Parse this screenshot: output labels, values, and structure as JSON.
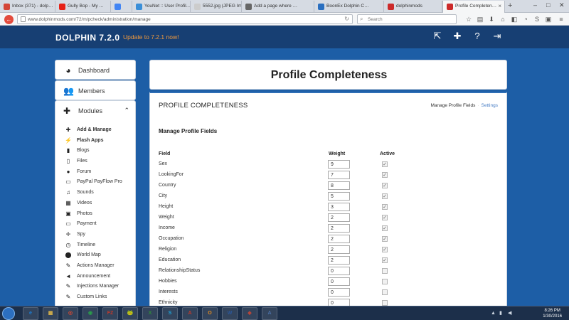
{
  "browser": {
    "tabs": [
      {
        "label": "Inbox (371) - dolp…",
        "color": "#d44638"
      },
      {
        "label": "Gully Bop - My …",
        "color": "#e62117"
      },
      {
        "label": "",
        "color": "#4285f4"
      },
      {
        "label": "YouNet :: User Profil…",
        "color": "#3b8fd8"
      },
      {
        "label": "5552.jpg (JPEG Ima…",
        "color": "#cccccc"
      },
      {
        "label": "Add a page where …",
        "color": "#666666"
      },
      {
        "label": "BoonEx Dolphin C…",
        "color": "#2a6fc0"
      },
      {
        "label": "dolphinmods",
        "color": "#cc2a2a"
      },
      {
        "label": "Profile Completen…",
        "color": "#cc2a2a"
      }
    ],
    "url": "www.dolphinmods.com/72/m/pcheck/administration/manage",
    "search_placeholder": "Search"
  },
  "header": {
    "brand": "DOLPHIN 7.2.0",
    "update_link": "Update to 7.2.1 now!"
  },
  "sidebar": {
    "dashboard": "Dashboard",
    "members": "Members",
    "modules": "Modules",
    "module_items": [
      {
        "label": "Add & Manage",
        "icon": "plus-icon",
        "bold": true
      },
      {
        "label": "Flash Apps",
        "icon": "bolt-icon",
        "bold": true
      },
      {
        "label": "Blogs",
        "icon": "book-icon",
        "bold": false
      },
      {
        "label": "Files",
        "icon": "file-icon",
        "bold": false
      },
      {
        "label": "Forum",
        "icon": "comments-icon",
        "bold": false
      },
      {
        "label": "PayPal PayFlow Pro",
        "icon": "card-icon",
        "bold": false
      },
      {
        "label": "Sounds",
        "icon": "music-icon",
        "bold": false
      },
      {
        "label": "Videos",
        "icon": "film-icon",
        "bold": false
      },
      {
        "label": "Photos",
        "icon": "photo-icon",
        "bold": false
      },
      {
        "label": "Payment",
        "icon": "card-icon",
        "bold": false
      },
      {
        "label": "Spy",
        "icon": "crosshair-icon",
        "bold": false
      },
      {
        "label": "Timeline",
        "icon": "clock-icon",
        "bold": false
      },
      {
        "label": "World Map",
        "icon": "map-marker-icon",
        "bold": false
      },
      {
        "label": "Actions Manager",
        "icon": "wrench-icon",
        "bold": false
      },
      {
        "label": "Announcement",
        "icon": "bullhorn-icon",
        "bold": false
      },
      {
        "label": "Injections Manager",
        "icon": "wrench-icon",
        "bold": false
      },
      {
        "label": "Custom Links",
        "icon": "wrench-icon",
        "bold": false
      }
    ]
  },
  "main": {
    "page_title": "Profile Completeness",
    "section_title": "PROFILE COMPLETENESS",
    "link_manage": "Manage Profile Fields",
    "link_settings": "Settings",
    "manage_title": "Manage Profile Fields",
    "columns": {
      "field": "Field",
      "weight": "Weight",
      "active": "Active"
    },
    "fields": [
      {
        "name": "Sex",
        "weight": "9",
        "active": true
      },
      {
        "name": "LookingFor",
        "weight": "7",
        "active": true
      },
      {
        "name": "Country",
        "weight": "8",
        "active": true
      },
      {
        "name": "City",
        "weight": "5",
        "active": true
      },
      {
        "name": "Height",
        "weight": "3",
        "active": true
      },
      {
        "name": "Weight",
        "weight": "2",
        "active": true
      },
      {
        "name": "Income",
        "weight": "2",
        "active": true
      },
      {
        "name": "Occupation",
        "weight": "2",
        "active": true
      },
      {
        "name": "Religion",
        "weight": "2",
        "active": true
      },
      {
        "name": "Education",
        "weight": "2",
        "active": true
      },
      {
        "name": "RelationshipStatus",
        "weight": "0",
        "active": false
      },
      {
        "name": "Hobbies",
        "weight": "0",
        "active": false
      },
      {
        "name": "Interests",
        "weight": "0",
        "active": false
      },
      {
        "name": "Ethnicity",
        "weight": "0",
        "active": false
      }
    ]
  },
  "taskbar": {
    "apps": [
      "e",
      "▦",
      "◎",
      "◉",
      "FZ",
      "🐸",
      "X",
      "S",
      "A",
      "O",
      "W",
      "◆",
      "A"
    ],
    "time": "8:26 PM",
    "date": "1/30/2016"
  }
}
